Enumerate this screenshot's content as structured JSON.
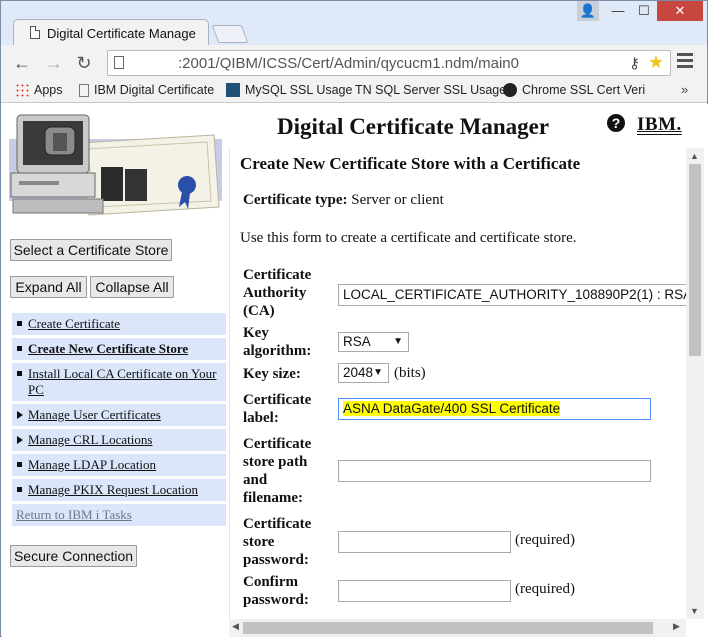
{
  "browser": {
    "tab_title": "Digital Certificate Manage",
    "url": ":2001/QIBM/ICSS/Cert/Admin/qycucm1.ndm/main0",
    "window_controls": {
      "minimize": "—",
      "maximize": "☐",
      "close": "✕",
      "user": "👤"
    },
    "nav": {
      "back": "←",
      "forward": "→",
      "reload": "↻"
    },
    "bookmarks": [
      {
        "label": "Apps",
        "icon": "apps-grid-icon"
      },
      {
        "label": "IBM Digital Certificate",
        "icon": "page-icon"
      },
      {
        "label": "MySQL SSL Usage",
        "icon": "mysql-icon"
      },
      {
        "label": "TN SQL Server SSL Usage",
        "icon": ""
      },
      {
        "label": "Chrome SSL Cert Veri",
        "icon": "github-icon"
      }
    ],
    "bookmarks_more": "»"
  },
  "left_panel": {
    "select_store_button": "Select a Certificate Store",
    "expand_all_button": "Expand All",
    "collapse_all_button": "Collapse All",
    "nav_items": [
      {
        "label": "Create Certificate",
        "marker": "bullet"
      },
      {
        "label": "Create New Certificate Store",
        "marker": "bullet",
        "current": true
      },
      {
        "label": "Install Local CA Certificate on Your PC",
        "marker": "bullet"
      },
      {
        "label": "Manage User Certificates",
        "marker": "triangle"
      },
      {
        "label": "Manage CRL Locations",
        "marker": "triangle"
      },
      {
        "label": "Manage LDAP Location",
        "marker": "bullet"
      },
      {
        "label": "Manage PKIX Request Location",
        "marker": "bullet"
      },
      {
        "label": "Return to IBM i Tasks",
        "marker": "none"
      }
    ],
    "secure_connection_button": "Secure Connection"
  },
  "header": {
    "title": "Digital Certificate Manager",
    "help": "?",
    "brand": "IBM."
  },
  "form": {
    "heading": "Create New Certificate Store with a Certificate",
    "certificate_type_label": "Certificate type:",
    "certificate_type_value": "Server or client",
    "intro": "Use this form to create a certificate and certificate store.",
    "ca_label": [
      "Certificate",
      "Authority",
      "(CA)"
    ],
    "ca_value": "LOCAL_CERTIFICATE_AUTHORITY_108890P2(1) : RSA",
    "key_algorithm_label": [
      "Key",
      "algorithm:"
    ],
    "key_algorithm_value": "RSA",
    "key_size_label": "Key size:",
    "key_size_value": "2048",
    "key_size_unit": "(bits)",
    "cert_label_label": [
      "Certificate",
      "label:"
    ],
    "cert_label_value": "ASNA DataGate/400 SSL Certificate",
    "store_path_label": [
      "Certificate",
      "store path",
      "and",
      "filename:"
    ],
    "store_path_value": "",
    "store_password_label": [
      "Certificate",
      "store",
      "password:"
    ],
    "store_password_value": "",
    "required_text": "(required)",
    "confirm_label": [
      "Confirm",
      "password:"
    ],
    "confirm_value": "",
    "confirm_required_text": "(required)"
  },
  "colors": {
    "nav_bg": "#dbe6fa",
    "highlight": "#ffff00",
    "focus_border": "#4d90fe",
    "close_button": "#c7463d"
  }
}
